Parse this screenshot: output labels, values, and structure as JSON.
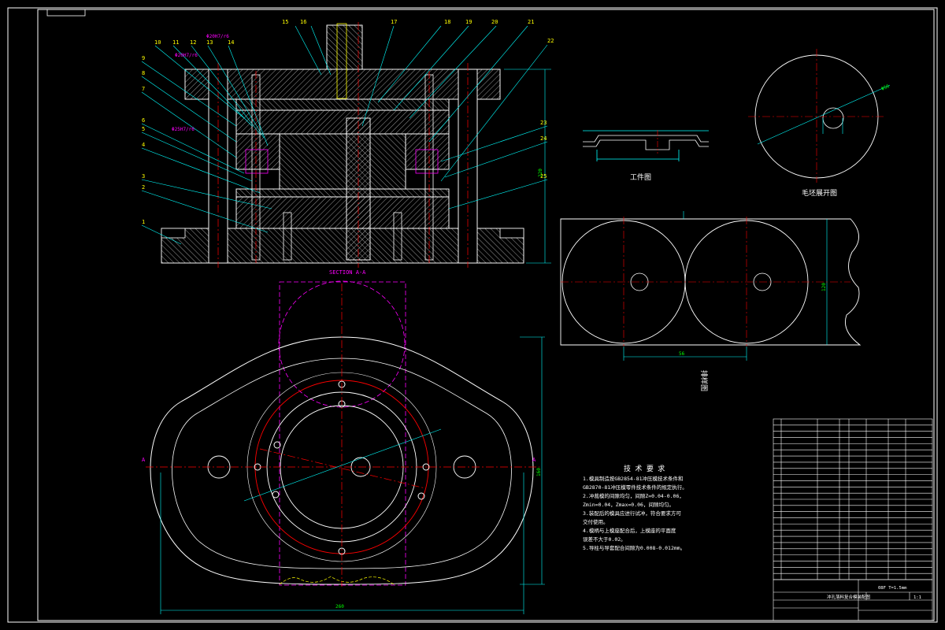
{
  "drawing": {
    "section_label": "SECTION A-A",
    "cut_markers": [
      "A",
      "A"
    ],
    "part_numbers_top": [
      "15",
      "16",
      "17",
      "18",
      "19",
      "20",
      "21",
      "22"
    ],
    "part_numbers_left": [
      "10",
      "11",
      "12",
      "13",
      "14",
      "9",
      "8",
      "7",
      "6",
      "5",
      "4",
      "3",
      "2",
      "1"
    ],
    "part_numbers_right": [
      "23",
      "24",
      "25"
    ],
    "fit_notes": [
      "Φ20H7/r6",
      "Φ20H7/r6",
      "Φ25H7/r6"
    ]
  },
  "views": {
    "workpiece_label": "工件图",
    "blank_label": "毛坯展开图",
    "layout_label": "排样图"
  },
  "dimensions": {
    "base_width": "260",
    "base_height": "160",
    "press_height": "220",
    "strip_width": "120",
    "pitch": "56",
    "blank_dia": "Φ56"
  },
  "tech": {
    "title": "技 术 要 求",
    "lines": [
      "1.模具制造按GB2854-81冲压模技术条件和",
      "GB2870-81冲压模零件技术条件的规定执行。",
      "2.冲裁模的间隙均匀，间隙Z=0.04-0.06，",
      "Zmin=0.04，Zmax=0.06，间隙均匀。",
      "3.装配后的模具应进行试冲，符合要求方可",
      "交付使用。",
      "4.模柄与上模座配合后，上模座的平面度",
      "误差不大于0.02。",
      "5.导柱与导套配合间隙为0.008-0.012mm。"
    ]
  },
  "title_block": {
    "name": "冲孔落料复合模装配图",
    "scale": "1:1",
    "material": "08F T=1.5mm"
  },
  "colors": {
    "outline": "#ffffff",
    "hatch": "#ffffff",
    "center": "#ff0000",
    "leader": "#00ffff",
    "dim": "#00ff00",
    "dash_magenta": "#ff00ff",
    "yellow": "#ffff00"
  }
}
